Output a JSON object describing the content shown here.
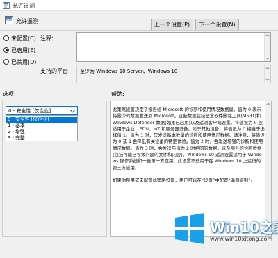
{
  "window": {
    "title": "允许遥测"
  },
  "header": {
    "title": "允许遥测"
  },
  "buttons": {
    "prev": "上一个设置(P)",
    "next": "下一个设置(N)"
  },
  "radios": [
    {
      "label": "未配置(C)",
      "selected": false
    },
    {
      "label": "已启用(E)",
      "selected": true
    },
    {
      "label": "已禁用(D)",
      "selected": false
    }
  ],
  "comment": {
    "label": "注释:",
    "value": ""
  },
  "supported": {
    "label": "支持的平台:",
    "value": "至少为 Windows 10 Server、Windows 10"
  },
  "sections": {
    "options": "选项:",
    "help": "帮助:"
  },
  "dropdown": {
    "selected": "0 - 安全性 [仅企业]",
    "options": [
      "0 - 安全性 [仅企业]",
      "1 - 基本",
      "2 - 增强",
      "3 - 完整"
    ]
  },
  "help": {
    "p1": "此策略设置决定了报告给 Microsoft 的诊断和使用情况数据量。值为 0 表示将最少的数据发送到 Microsoft。这些数据包括恶意软件删除工具(MSRT)和 Windows Defender 数据(如果已启用)以及遥测客户端设置。将值设为 0 仅适用于企业、EDU、IoT 和服务器设备。对于其他设备，将值设为 0 相当于选择值 1。值为 1 时，只发送基本数量的诊断和使用情况数据。请注意，将值设为 0 或 1 会降低有关设备的特定体验。值为 2 时，会发送增强的诊断和使用情况数据。值为 3 时，会发送与值为 2 时相同的数据，以及额外的诊断数据(包括可能已导致问题的文件和内容)。Windows 10 遥测设置适用于 Windows 操作系统和一些第一方应用。此设置不适用于在 Windows 10 上运行的第三方应用。",
    "p2": "如果你禁用或未配置此策略设置，用户可以在“设置”中配置“遥测级别”。"
  },
  "watermark": {
    "brand": "Win10之家",
    "url": "www.win10xitong.com"
  }
}
